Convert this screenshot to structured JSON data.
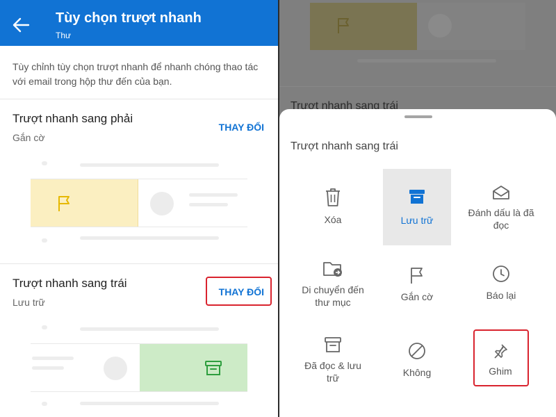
{
  "settings": {
    "title": "Tùy chọn trượt nhanh",
    "subtitle": "Thư",
    "description": "Tùy chỉnh tùy chọn trượt nhanh để nhanh chóng thao tác với email trong hộp thư đến của bạn.",
    "swipe_right": {
      "title": "Trượt nhanh sang phải",
      "value": "Gắn cờ",
      "change_label": "THAY ĐỔI"
    },
    "swipe_left": {
      "title": "Trượt nhanh sang trái",
      "value": "Lưu trữ",
      "change_label": "THAY ĐỔI"
    }
  },
  "background": {
    "partial_title": "Trượt nhanh sang trái"
  },
  "sheet": {
    "title": "Trượt nhanh sang trái",
    "options": [
      {
        "label": "Xóa",
        "icon": "trash-icon",
        "selected": false
      },
      {
        "label": "Lưu trữ",
        "icon": "archive-icon",
        "selected": true
      },
      {
        "label": "Đánh dấu là đã đọc",
        "icon": "open-envelope-icon",
        "selected": false
      },
      {
        "label": "Di chuyển đến thư mục",
        "icon": "move-folder-icon",
        "selected": false
      },
      {
        "label": "Gắn cờ",
        "icon": "flag-icon",
        "selected": false
      },
      {
        "label": "Báo lại",
        "icon": "clock-icon",
        "selected": false
      },
      {
        "label": "Đã đọc & lưu trữ",
        "icon": "read-archive-icon",
        "selected": false
      },
      {
        "label": "Không",
        "icon": "none-icon",
        "selected": false
      },
      {
        "label": "Ghim",
        "icon": "pin-icon",
        "selected": false
      }
    ]
  },
  "colors": {
    "accent": "#1173d4",
    "highlight": "#d9232e",
    "flag_bg": "#fbefc1",
    "archive_bg": "#cdebc7",
    "archive_icon": "#2e9e3e",
    "flag_icon": "#e6b800"
  }
}
